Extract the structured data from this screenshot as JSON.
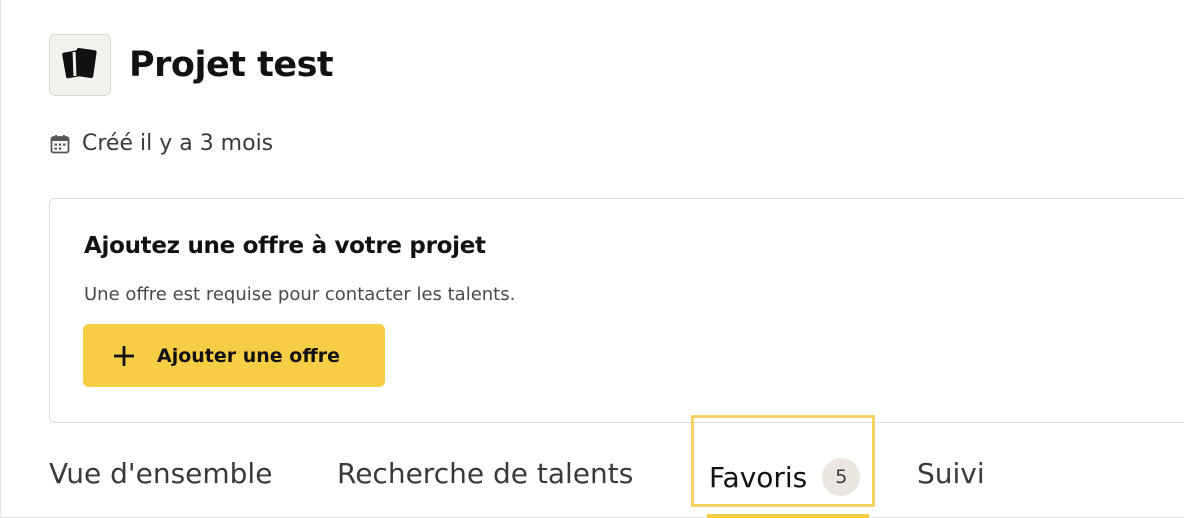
{
  "project": {
    "title": "Projet test",
    "logo_icon": "cards-icon",
    "created_text": "Créé il y a 3 mois",
    "created_icon": "calendar-icon"
  },
  "offer_card": {
    "title": "Ajoutez une offre à votre projet",
    "subtitle": "Une offre est requise pour contacter les talents.",
    "button_label": "Ajouter une offre",
    "button_icon": "plus-icon",
    "button_color": "#f6ce45"
  },
  "tabs": [
    {
      "label": "Vue d'ensemble"
    },
    {
      "label": "Recherche de talents"
    },
    {
      "label": "Favoris",
      "count": "5",
      "active": true
    },
    {
      "label": "Suivi"
    }
  ],
  "colors": {
    "accent": "#f6ce45",
    "highlight_border": "#f6d164",
    "badge_bg": "#ebe7e0"
  }
}
